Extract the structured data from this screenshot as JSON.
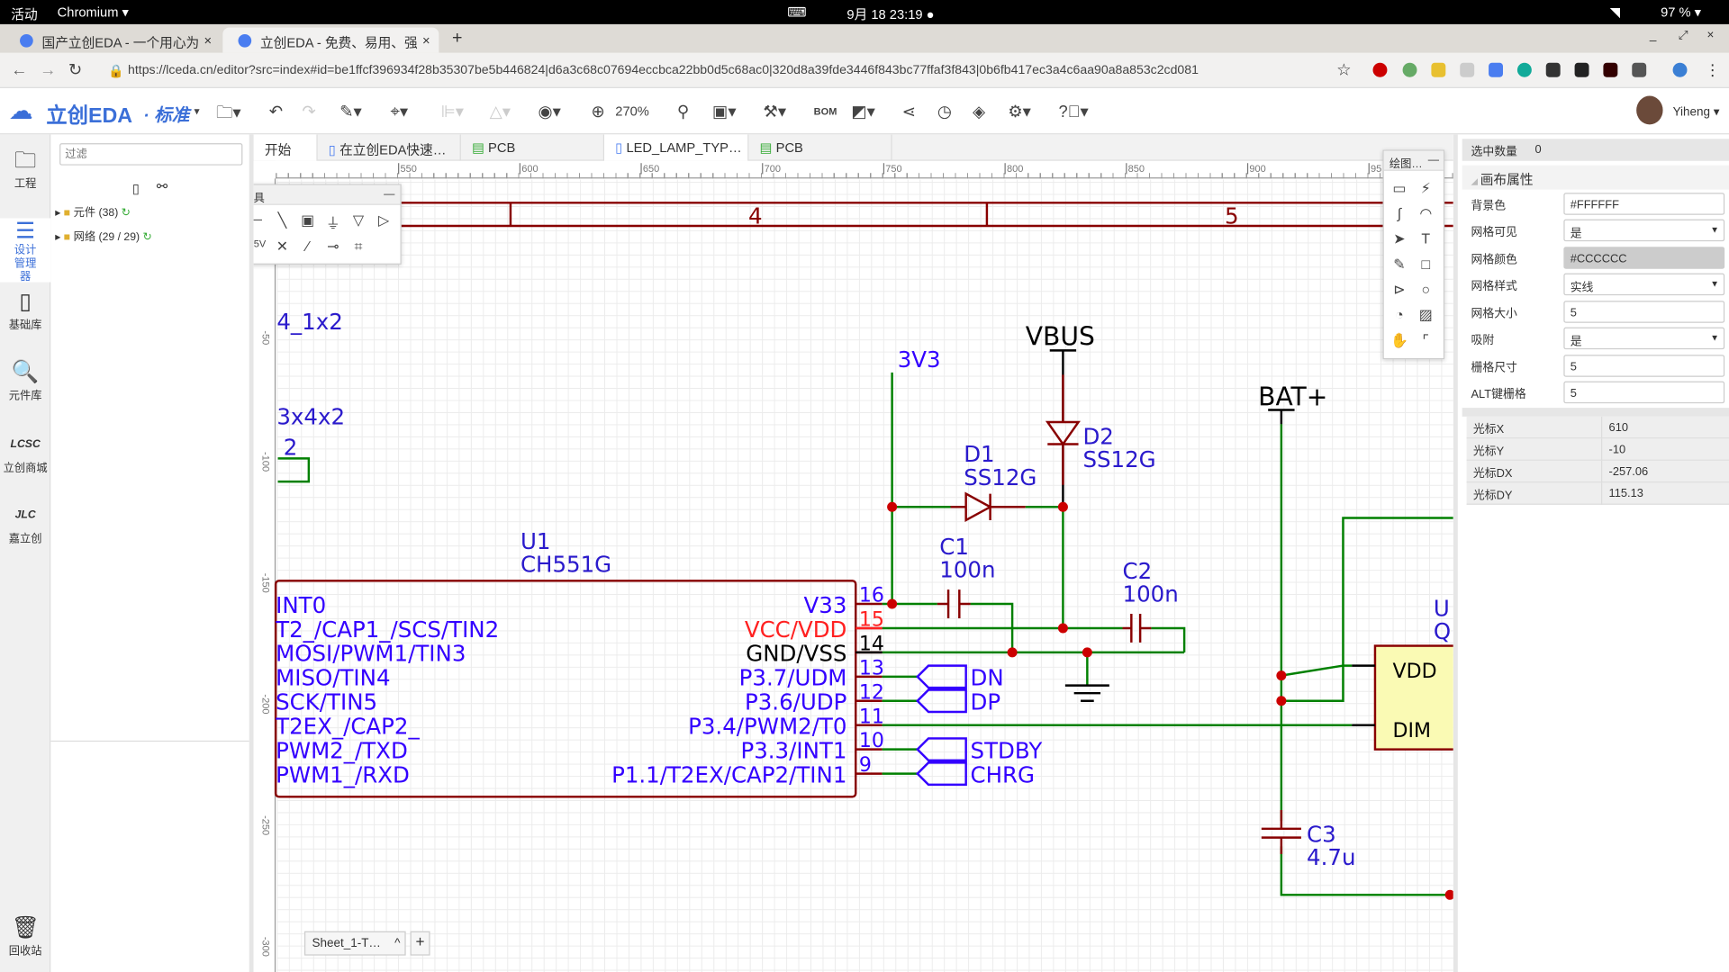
{
  "system": {
    "activities": "活动",
    "app": "Chromium ▾",
    "datetime": "9月 18 23:19 ●",
    "battery": "97 % ▾"
  },
  "browser": {
    "tabs": [
      {
        "label": "国产立创EDA - 一个用心为"
      },
      {
        "label": "立创EDA - 免费、易用、强"
      }
    ],
    "new_tab": "+",
    "url": "https://lceda.cn/editor?src=index#id=be1ffcf396934f28b35307be5b446824|d6a3c68c07694eccbca22bb0d5c68ac0|320d8a39fde3446f843bc77ffaf3f843|0b6fb417ec3a4c6aa90a8a853c2cd081"
  },
  "toolbar": {
    "logo": "立创EDA",
    "edition": "· 标准",
    "zoom": "270%",
    "bom": "BOM",
    "user": "Yiheng ▾"
  },
  "rail": [
    {
      "label": "工程",
      "icon": "folder-icon"
    },
    {
      "label": "设计管理器",
      "icon": "design-manager-icon"
    },
    {
      "label": "基础库",
      "icon": "chip-icon"
    },
    {
      "label": "元件库",
      "icon": "search-component-icon"
    },
    {
      "label": "立创商城",
      "icon": "lcsc-icon"
    },
    {
      "label": "嘉立创",
      "icon": "jlc-icon"
    },
    {
      "label": "回收站",
      "icon": "trash-icon"
    }
  ],
  "left_panel": {
    "filter_placeholder": "过滤",
    "tree": [
      {
        "label": "元件 (38)"
      },
      {
        "label": "网络 (29 / 29)"
      }
    ]
  },
  "doc_tabs": [
    {
      "label": "开始"
    },
    {
      "label": "在立创EDA快速…"
    },
    {
      "label": "PCB"
    },
    {
      "label": "LED_LAMP_TYP…"
    },
    {
      "label": "PCB"
    }
  ],
  "ruler": {
    "h": [
      "550",
      "600",
      "650",
      "700",
      "750",
      "800",
      "850",
      "900",
      "95"
    ],
    "v": [
      "-50",
      "-100",
      "-150",
      "-200",
      "-250",
      "-300"
    ]
  },
  "electric_tools": {
    "title": "电气工具",
    "minimize": "—"
  },
  "drawing_tools": {
    "title": "绘图…",
    "minimize": "—"
  },
  "sheet_tab": {
    "label": "Sheet_1-T…",
    "add": "+"
  },
  "schematic": {
    "frame": [
      "4",
      "5"
    ],
    "texts": {
      "t1": "4_1x2",
      "t2": "3x4x2",
      "t3": "2",
      "vbus": "VBUS",
      "v3": "3V3",
      "batp": "BAT+",
      "d1": "D1",
      "d1v": "SS12G",
      "d2": "D2",
      "d2v": "SS12G",
      "c1": "C1",
      "c1v": "100n",
      "c2": "C2",
      "c2v": "100n",
      "c3": "C3",
      "c3v": "4.7u",
      "u1": "U1",
      "u1v": "CH551G",
      "vdd": "VDD",
      "dim": "DIM",
      "u2": "U",
      "u2v": "Q"
    },
    "left_pins": [
      "INT0",
      "T2_/CAP1_/SCS/TIN2",
      "MOSI/PWM1/TIN3",
      "MISO/TIN4",
      "SCK/TIN5",
      "T2EX_/CAP2_",
      "PWM2_/TXD",
      "PWM1_/RXD"
    ],
    "right_pins": [
      {
        "num": "16",
        "name": "V33"
      },
      {
        "num": "15",
        "name": "VCC/VDD"
      },
      {
        "num": "14",
        "name": "GND/VSS"
      },
      {
        "num": "13",
        "name": "P3.7/UDM"
      },
      {
        "num": "12",
        "name": "P3.6/UDP"
      },
      {
        "num": "11",
        "name": "P3.4/PWM2/T0"
      },
      {
        "num": "10",
        "name": "P3.3/INT1"
      },
      {
        "num": "9",
        "name": "P1.1/T2EX/CAP2/TIN1"
      }
    ],
    "net_flags": [
      "DN",
      "DP",
      "STDBY",
      "CHRG"
    ],
    "colors": {
      "wire": "#008000",
      "symbol": "#880000",
      "pin_text": "#3300ff",
      "junction": "#cc0000"
    }
  },
  "right_panel": {
    "selected_label": "选中数量",
    "selected_value": "0",
    "section": "画布属性",
    "props": [
      {
        "label": "背景色",
        "value": "#FFFFFF"
      },
      {
        "label": "网格可见",
        "value": "是"
      },
      {
        "label": "网格颜色",
        "value": "#CCCCCC"
      },
      {
        "label": "网格样式",
        "value": "实线"
      },
      {
        "label": "网格大小",
        "value": "5"
      },
      {
        "label": "吸附",
        "value": "是"
      },
      {
        "label": "栅格尺寸",
        "value": "5"
      },
      {
        "label": "ALT键栅格",
        "value": "5"
      }
    ],
    "cursor": [
      {
        "label": "光标X",
        "value": "610"
      },
      {
        "label": "光标Y",
        "value": "-10"
      },
      {
        "label": "光标DX",
        "value": "-257.06"
      },
      {
        "label": "光标DY",
        "value": "115.13"
      }
    ]
  }
}
